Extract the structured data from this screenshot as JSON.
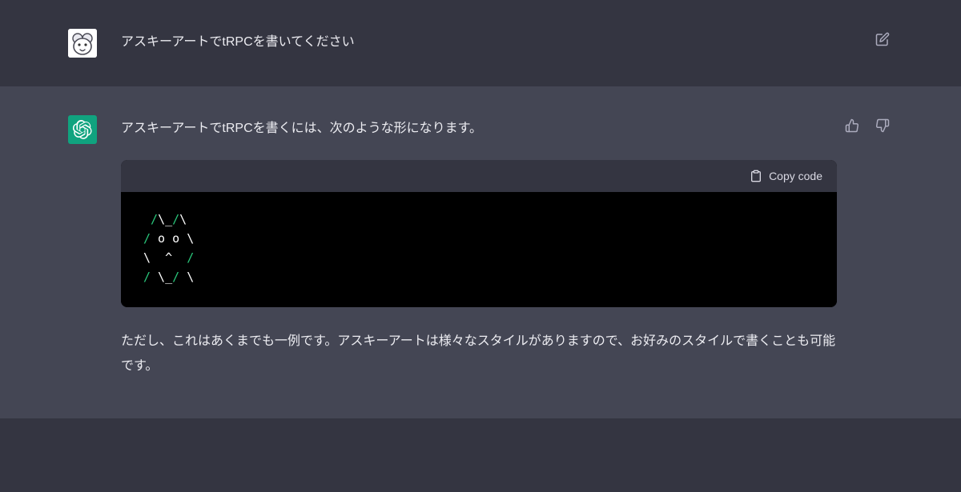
{
  "messages": {
    "user": {
      "text": "アスキーアートでtRPCを書いてください"
    },
    "assistant": {
      "intro": "アスキーアートでtRPCを書くには、次のような形になります。",
      "copy_label": "Copy code",
      "code_lines": [
        [
          {
            "t": " ",
            "c": ""
          },
          {
            "t": "/",
            "c": "slash"
          },
          {
            "t": "\\_",
            "c": ""
          },
          {
            "t": "/",
            "c": "slash"
          },
          {
            "t": "\\",
            "c": ""
          }
        ],
        [
          {
            "t": "/",
            "c": "slash"
          },
          {
            "t": " o o ",
            "c": ""
          },
          {
            "t": "\\",
            "c": ""
          }
        ],
        [
          {
            "t": "\\  ^  ",
            "c": ""
          },
          {
            "t": "/",
            "c": "slash"
          }
        ],
        [
          {
            "t": "/",
            "c": "slash"
          },
          {
            "t": " \\_",
            "c": ""
          },
          {
            "t": "/",
            "c": "slash"
          },
          {
            "t": " ",
            "c": ""
          },
          {
            "t": "\\",
            "c": ""
          }
        ]
      ],
      "outro": "ただし、これはあくまでも一例です。アスキーアートは様々なスタイルがありますので、お好みのスタイルで書くことも可能です。"
    }
  },
  "icons": {
    "edit": "edit-icon",
    "thumbs_up": "thumbs-up-icon",
    "thumbs_down": "thumbs-down-icon",
    "clipboard": "clipboard-icon"
  }
}
